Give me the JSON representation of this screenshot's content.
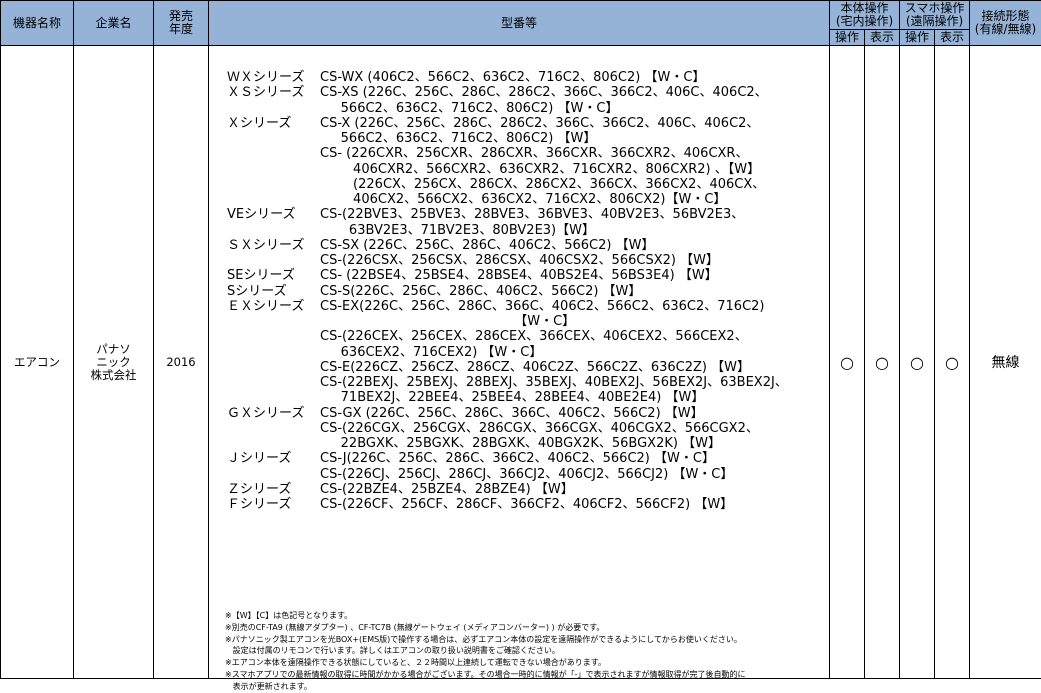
{
  "headers": {
    "device": "機器名称",
    "company": "企業名",
    "year_line1": "発売",
    "year_line2": "年度",
    "model": "型番等",
    "unit_op_line1": "本体操作",
    "unit_op_line2": "(宅内操作)",
    "phone_op_line1": "スマホ操作",
    "phone_op_line2": "(遠隔操作)",
    "op1": "操作",
    "disp1": "表示",
    "op2": "操作",
    "disp2": "表示",
    "conn_line1": "接続形態",
    "conn_line2": "(有線/無線)"
  },
  "row": {
    "device": "エアコン",
    "company_line1": "パナソ",
    "company_line2": "ニック",
    "company_line3": "株式会社",
    "year": "2016",
    "op1": "○",
    "disp1": "○",
    "op2": "○",
    "disp2": "○",
    "connection": "無線"
  },
  "models": [
    {
      "label": "ＷＸシリーズ",
      "text": "CS-WX (406C2、566C2、636C2、716C2、806C2) 【W・C】"
    },
    {
      "label": "ＸＳシリーズ",
      "text": "CS-XS (226C、256C、286C、286C2、366C、366C2、406C、406C2、"
    },
    {
      "label": "",
      "text": "     566C2、636C2、716C2、806C2) 【W・C】"
    },
    {
      "label": "Ｘシリーズ",
      "text": "CS-X (226C、256C、286C、286C2、366C、366C2、406C、406C2、"
    },
    {
      "label": "",
      "text": "     566C2、636C2、716C2、806C2) 【W】"
    },
    {
      "label": "",
      "text": "CS- (226CXR、256CXR、286CXR、366CXR、366CXR2、406CXR、"
    },
    {
      "label": "",
      "text": "        406CXR2、566CXR2、636CXR2、716CXR2、806CXR2) 、【W】"
    },
    {
      "label": "",
      "text": "        (226CX、256CX、286CX、286CX2、366CX、366CX2、406CX、"
    },
    {
      "label": "",
      "text": "        406CX2、566CX2、636CX2、716CX2、806CX2)【W・C】"
    },
    {
      "label": "VEシリーズ",
      "text": "CS-(22BVE3、25BVE3、28BVE3、36BVE3、40BV2E3、56BV2E3、"
    },
    {
      "label": "",
      "text": "       63BV2E3、71BV2E3、80BV2E3)【W】"
    },
    {
      "label": "ＳＸシリーズ",
      "text": "CS-SX (226C、256C、286C、406C2、566C2) 【W】"
    },
    {
      "label": "",
      "text": "CS-(226CSX、256CSX、286CSX、406CSX2、566CSX2) 【W】"
    },
    {
      "label": "SEシリーズ",
      "text": "CS- (22BSE4、25BSE4、28BSE4、40BS2E4、56BS3E4) 【W】"
    },
    {
      "label": "Sシリーズ",
      "text": "CS-S(226C、256C、286C、406C2、566C2) 【W】"
    },
    {
      "label": "ＥＸシリーズ",
      "text": "CS-EX(226C、256C、286C、366C、406C2、566C2、636C2、716C2)"
    },
    {
      "label": "",
      "text": "                                               【W・C】"
    },
    {
      "label": "",
      "text": "CS-(226CEX、256CEX、286CEX、366CEX、406CEX2、566CEX2、"
    },
    {
      "label": "",
      "text": "     636CEX2、716CEX2) 【W・C】"
    },
    {
      "label": "",
      "text": "CS-E(226CZ、256CZ、286CZ、406C2Z、566C2Z、636C2Z) 【W】"
    },
    {
      "label": "",
      "text": "CS-(22BEXJ、25BEXJ、28BEXJ、35BEXJ、40BEX2J、56BEX2J、63BEX2J、"
    },
    {
      "label": "",
      "text": "     71BEX2J、22BEE4、25BEE4、28BEE4、40BE2E4) 【W】"
    },
    {
      "label": "ＧＸシリーズ",
      "text": "CS-GX (226C、256C、286C、366C、406C2、566C2) 【W】"
    },
    {
      "label": "",
      "text": "CS-(226CGX、256CGX、286CGX、366CGX、406CGX2、566CGX2、"
    },
    {
      "label": "",
      "text": "     22BGXK、25BGXK、28BGXK、40BGX2K、56BGX2K) 【W】"
    },
    {
      "label": "Ｊシリーズ",
      "text": "CS-J(226C、256C、286C、366C2、406C2、566C2) 【W・C】"
    },
    {
      "label": "",
      "text": "CS-(226CJ、256CJ、286CJ、366CJ2、406CJ2、566CJ2) 【W・C】"
    },
    {
      "label": "Ｚシリーズ",
      "text": "CS-(22BZE4、25BZE4、28BZE4) 【W】"
    },
    {
      "label": "Ｆシリーズ",
      "text": "CS-(226CF、256CF、286CF、366CF2、406CF2、566CF2) 【W】"
    }
  ],
  "notes": [
    "※【W】【C】は色記号となります。",
    "※別売のCF-TA9 (無線アダプター) 、CF-TC7B (無線ゲートウェイ (メディアコンバーター) ) が必要です。",
    "※パナソニック製エアコンを光BOX+(EMS版)で操作する場合は、必ずエアコン本体の設定を遠隔操作ができるようにしてからお使いください。",
    "   設定は付属のリモコンで行います。詳しくはエアコンの取り扱い説明書をご確認ください。",
    "※エアコン本体を遠隔操作できる状態にしていると、２２時間以上連続して運転できない場合があります。",
    "※スマホアプリでの最新情報の取得に時間がかかる場合がございます。その場合一時的に情報が「-」で表示されますが情報取得が完了後自動的に",
    "   表示が更新されます。"
  ],
  "colors": {
    "header_bg": "#95b3d7",
    "border": "#000000",
    "body_bg": "#ffffff"
  }
}
